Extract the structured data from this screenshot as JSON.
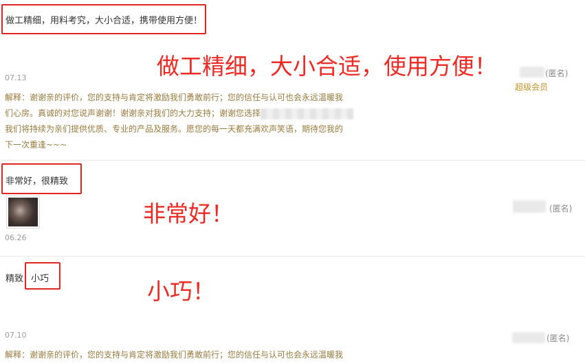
{
  "reviews": [
    {
      "text": "做工精细，用料考究，大小合适，携带使用方便！",
      "annotation": "做工精细，大小合适，使用方便！",
      "date": "07.13",
      "user": "(匿名)",
      "badge": "超级会员",
      "reply": {
        "line1": "解释：谢谢亲的评价，您的支持与肯定将激励我们勇敢前行；您的信任与认可也会永远温暖我",
        "line2": "们心房。真诚的对您说声谢谢！谢谢亲对我们的大力支持；谢谢您选择",
        "line3": "我们将持续为亲们提供优质、专业的产品及服务。愿您的每一天都充满欢声笑语，期待您我的",
        "line4": "下一次重逢~~~"
      }
    },
    {
      "text": "非常好，很精致",
      "annotation": "非常好！",
      "date": "06.26",
      "user": "(匿名)"
    },
    {
      "text_prefix": "精致",
      "text_tag": "小巧",
      "annotation": "小巧！",
      "date": "07.10",
      "user": "(匿名)",
      "reply": {
        "line1": "解释：谢谢亲的评价，您的支持与肯定将激励我们勇敢前行；您的信任与认可也会永远温暖我"
      }
    }
  ],
  "colors": {
    "annotation": "#ee2a24",
    "reply_text": "#9a7a3d",
    "member_badge": "#c6932a",
    "date": "#9a9a9a"
  }
}
